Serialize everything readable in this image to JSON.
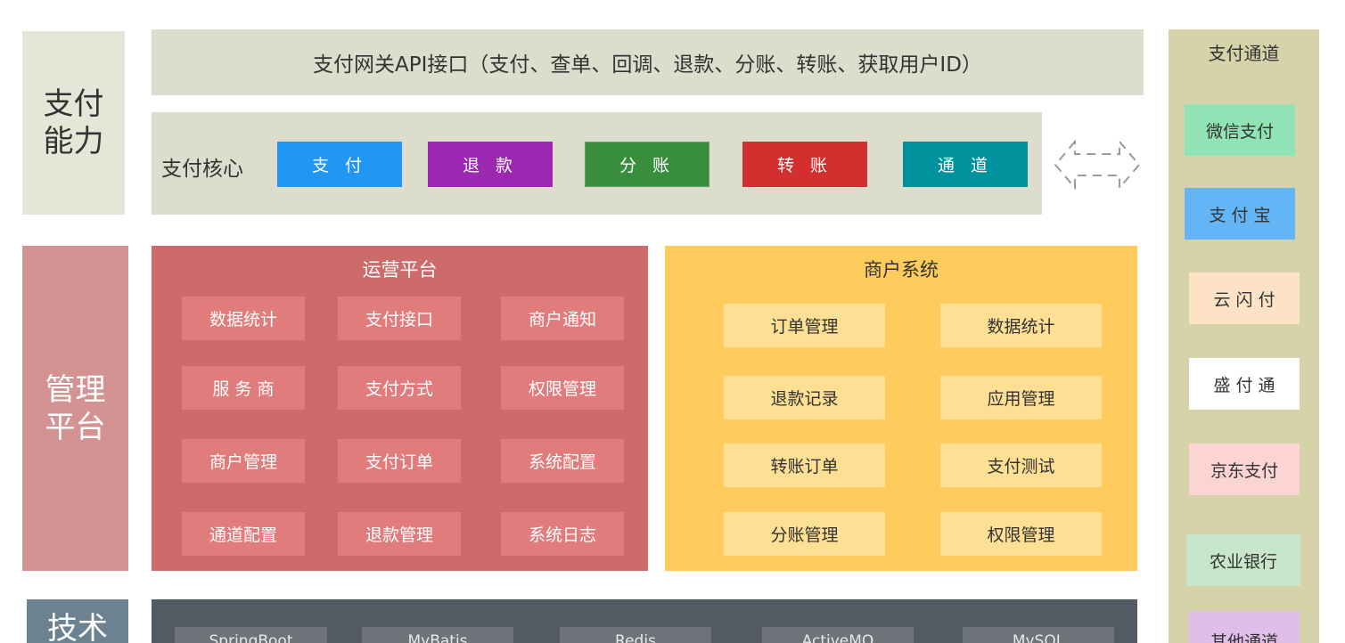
{
  "categories": {
    "pay_capability": "支付\n能力",
    "management": "管理\n平台",
    "tech": "技术"
  },
  "gateway": {
    "label": "支付网关API接口（支付、查单、回调、退款、分账、转账、获取用户ID）"
  },
  "core": {
    "title": "支付核心",
    "buttons": [
      {
        "label": "支 付",
        "color": "#2196f3"
      },
      {
        "label": "退 款",
        "color": "#9c27b0"
      },
      {
        "label": "分 账",
        "color": "#388e3c"
      },
      {
        "label": "转 账",
        "color": "#d32f2f"
      },
      {
        "label": "通 道",
        "color": "#00939e"
      }
    ]
  },
  "ops": {
    "title": "运营平台",
    "items": [
      "数据统计",
      "支付接口",
      "商户通知",
      "服 务 商",
      "支付方式",
      "权限管理",
      "商户管理",
      "支付订单",
      "系统配置",
      "通道配置",
      "退款管理",
      "系统日志"
    ]
  },
  "merchant": {
    "title": "商户系统",
    "items": [
      "订单管理",
      "数据统计",
      "退款记录",
      "应用管理",
      "转账订单",
      "支付测试",
      "分账管理",
      "权限管理"
    ]
  },
  "tech": {
    "items": [
      "SpringBoot",
      "MyBatis",
      "Redis",
      "ActiveMQ",
      "MySQL"
    ]
  },
  "channels": {
    "title": "支付通道",
    "items": [
      {
        "label": "微信支付",
        "color": "#8fe3b4"
      },
      {
        "label": "支 付 宝",
        "color": "#64b5f6"
      },
      {
        "label": "云 闪 付",
        "color": "#fde3c6"
      },
      {
        "label": "盛 付 通",
        "color": "#ffffff"
      },
      {
        "label": "京东支付",
        "color": "#fcd4d4"
      },
      {
        "label": "农业银行",
        "color": "#c8e6c9"
      },
      {
        "label": "其他通道",
        "color": "#e1bee7"
      }
    ]
  },
  "colors": {
    "pay_capability_bg": "#e6e6d8",
    "management_bg": "#d49393",
    "tech_bg": "#6d8291"
  }
}
